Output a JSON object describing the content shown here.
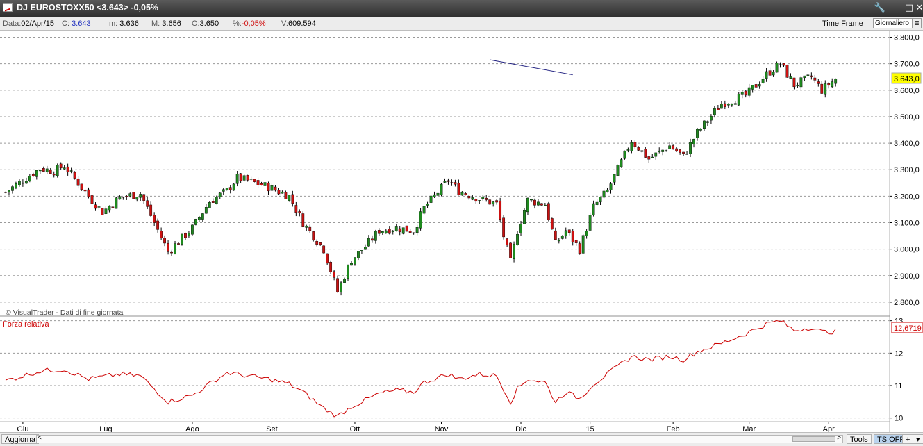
{
  "window": {
    "title": "DJ EUROSTOXX50 <3.643> -0,05%",
    "buttons": [
      "wrench-icon",
      "minimize-icon",
      "maximize-icon",
      "close-icon"
    ]
  },
  "infobar": {
    "data_label": "Data:",
    "data_value": "02/Apr/15",
    "close_label": "C:",
    "close_value": "3.643",
    "min_label": "m:",
    "min_value": "3.636",
    "max_label": "M:",
    "max_value": "3.656",
    "open_label": "O:",
    "open_value": "3.650",
    "pct_label": "%:",
    "pct_value": "-0,05%",
    "vol_label": "V:",
    "vol_value": "609.594",
    "timeframe_label": "Time Frame",
    "timeframe_value": "Giornaliero"
  },
  "bottombar": {
    "refresh_label": "Aggiorna",
    "tools_label": "Tools",
    "ts_label": "TS OFF",
    "plus_label": "+",
    "scroll_left": "<",
    "scroll_right": ">"
  },
  "colors": {
    "up": "#1f8a1f",
    "down": "#cc1111",
    "rsi_line": "#cc0000",
    "trendline": "#202080",
    "last_price_bg": "#ffff00"
  },
  "chart_data": [
    {
      "type": "candlestick",
      "title": "DJ EUROSTOXX50",
      "watermark": "© VisualTrader - Dati di fine giornata",
      "ylim": [
        2750,
        3825
      ],
      "y_ticks": [
        "2.800,0",
        "2.900,0",
        "3.000,0",
        "3.100,0",
        "3.200,0",
        "3.300,0",
        "3.400,0",
        "3.500,0",
        "3.600,0",
        "3.700,0",
        "3.800,0"
      ],
      "last_value_label": "3.643,0",
      "x_labels": [
        "Giu",
        "Lug",
        "Ago",
        "Set",
        "Ott",
        "Nov",
        "Dic",
        "15",
        "Feb",
        "Mar",
        "Apr"
      ],
      "trendline": {
        "from": [
          140,
          3715
        ],
        "to": [
          164,
          3658
        ]
      },
      "anchors": [
        [
          0,
          3215
        ],
        [
          10,
          3305
        ],
        [
          14,
          3295
        ],
        [
          17,
          3315
        ],
        [
          24,
          3200
        ],
        [
          28,
          3140
        ],
        [
          33,
          3195
        ],
        [
          39,
          3210
        ],
        [
          43,
          3100
        ],
        [
          47,
          2990
        ],
        [
          54,
          3080
        ],
        [
          59,
          3180
        ],
        [
          64,
          3220
        ],
        [
          67,
          3270
        ],
        [
          76,
          3235
        ],
        [
          82,
          3200
        ],
        [
          86,
          3100
        ],
        [
          92,
          3000
        ],
        [
          96,
          2840
        ],
        [
          100,
          2960
        ],
        [
          104,
          3010
        ],
        [
          108,
          3070
        ],
        [
          113,
          3080
        ],
        [
          118,
          3070
        ],
        [
          121,
          3155
        ],
        [
          128,
          3260
        ],
        [
          131,
          3220
        ],
        [
          137,
          3190
        ],
        [
          142,
          3170
        ],
        [
          144,
          3050
        ],
        [
          146,
          2950
        ],
        [
          148,
          3070
        ],
        [
          151,
          3185
        ],
        [
          156,
          3170
        ],
        [
          159,
          3020
        ],
        [
          162,
          3070
        ],
        [
          166,
          3000
        ],
        [
          170,
          3160
        ],
        [
          174,
          3220
        ],
        [
          181,
          3410
        ],
        [
          186,
          3340
        ],
        [
          192,
          3390
        ],
        [
          196,
          3350
        ],
        [
          200,
          3440
        ],
        [
          207,
          3550
        ],
        [
          214,
          3580
        ],
        [
          220,
          3660
        ],
        [
          224,
          3700
        ],
        [
          228,
          3620
        ],
        [
          233,
          3650
        ],
        [
          236,
          3600
        ],
        [
          240,
          3643
        ]
      ],
      "legend": "none",
      "grid": true
    },
    {
      "type": "line",
      "series_label": "Forza relativa",
      "ylim": [
        9.95,
        13.1
      ],
      "y_ticks": [
        "10",
        "11",
        "12",
        "13"
      ],
      "last_value_label": "12,6719",
      "anchors": [
        [
          0,
          11.15
        ],
        [
          10,
          11.45
        ],
        [
          17,
          11.5
        ],
        [
          24,
          11.2
        ],
        [
          33,
          11.35
        ],
        [
          39,
          11.3
        ],
        [
          43,
          10.9
        ],
        [
          47,
          10.5
        ],
        [
          54,
          10.7
        ],
        [
          59,
          11.05
        ],
        [
          64,
          11.4
        ],
        [
          67,
          11.35
        ],
        [
          76,
          11.2
        ],
        [
          82,
          11.05
        ],
        [
          86,
          10.8
        ],
        [
          92,
          10.3
        ],
        [
          96,
          10.05
        ],
        [
          100,
          10.35
        ],
        [
          104,
          10.55
        ],
        [
          108,
          10.75
        ],
        [
          113,
          10.85
        ],
        [
          118,
          10.8
        ],
        [
          121,
          11.1
        ],
        [
          128,
          11.35
        ],
        [
          131,
          11.2
        ],
        [
          137,
          11.35
        ],
        [
          142,
          11.3
        ],
        [
          146,
          10.5
        ],
        [
          148,
          10.9
        ],
        [
          151,
          11.2
        ],
        [
          156,
          11.1
        ],
        [
          159,
          10.5
        ],
        [
          162,
          10.8
        ],
        [
          166,
          10.6
        ],
        [
          170,
          11.05
        ],
        [
          174,
          11.35
        ],
        [
          181,
          11.9
        ],
        [
          186,
          11.8
        ],
        [
          192,
          11.9
        ],
        [
          196,
          11.8
        ],
        [
          200,
          12.05
        ],
        [
          207,
          12.3
        ],
        [
          214,
          12.6
        ],
        [
          220,
          12.9
        ],
        [
          224,
          13.0
        ],
        [
          228,
          12.7
        ],
        [
          233,
          12.8
        ],
        [
          236,
          12.65
        ],
        [
          240,
          12.67
        ]
      ],
      "legend": "none",
      "grid": true
    }
  ]
}
